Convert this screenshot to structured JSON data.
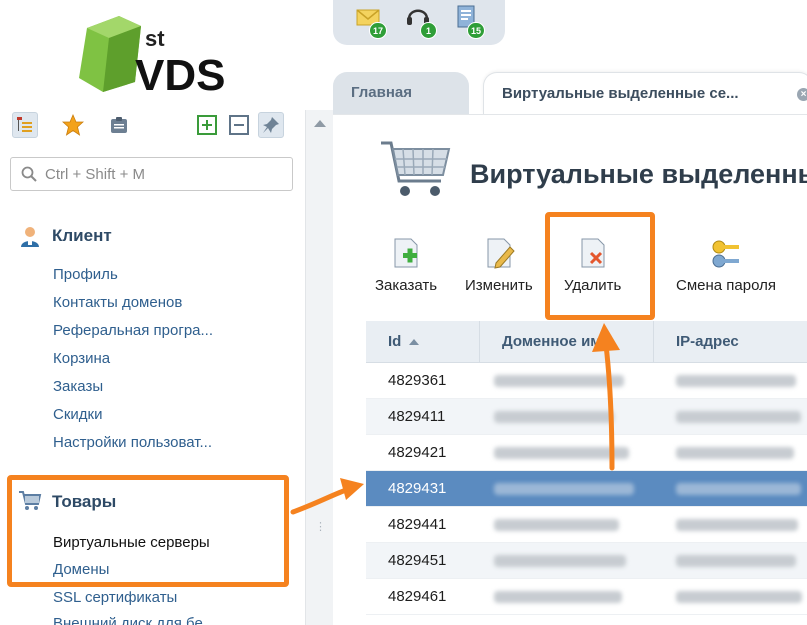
{
  "brand": {
    "logo_text": "VDS",
    "logo_sup": "st"
  },
  "sidebar": {
    "search_placeholder": "Ctrl + Shift + M",
    "groups": [
      {
        "title": "Клиент",
        "items": [
          "Профиль",
          "Контакты доменов",
          "Реферальная програ...",
          "Корзина",
          "Заказы",
          "Скидки",
          "Настройки пользоват..."
        ]
      },
      {
        "title": "Товары",
        "items": [
          "Виртуальные серверы",
          "Домены",
          "SSL сертификаты",
          "Внешний диск для бе..."
        ]
      }
    ]
  },
  "notifications": [
    {
      "icon": "mail-icon",
      "count": "17"
    },
    {
      "icon": "support-icon",
      "count": "1"
    },
    {
      "icon": "invoice-icon",
      "count": "15"
    }
  ],
  "tabs": [
    {
      "label": "Главная"
    },
    {
      "label": "Виртуальные выделенные се..."
    }
  ],
  "main": {
    "title": "Виртуальные выделенны",
    "actions": [
      {
        "label": "Заказать",
        "icon": "add-document-icon"
      },
      {
        "label": "Изменить",
        "icon": "edit-document-icon"
      },
      {
        "label": "Удалить",
        "icon": "delete-document-icon"
      },
      {
        "label": "Смена пароля",
        "icon": "keys-icon"
      }
    ],
    "columns": [
      "Id",
      "Доменное имя",
      "IP-адрес"
    ],
    "rows": [
      {
        "id": "4829361"
      },
      {
        "id": "4829411"
      },
      {
        "id": "4829421"
      },
      {
        "id": "4829431"
      },
      {
        "id": "4829441"
      },
      {
        "id": "4829451"
      },
      {
        "id": "4829461"
      }
    ],
    "selected_row": "4829431"
  },
  "colors": {
    "highlight": "#f5821f",
    "selected_row": "#5b8bc0",
    "badge": "#2f9e38",
    "logo_green": "#7fc243"
  }
}
